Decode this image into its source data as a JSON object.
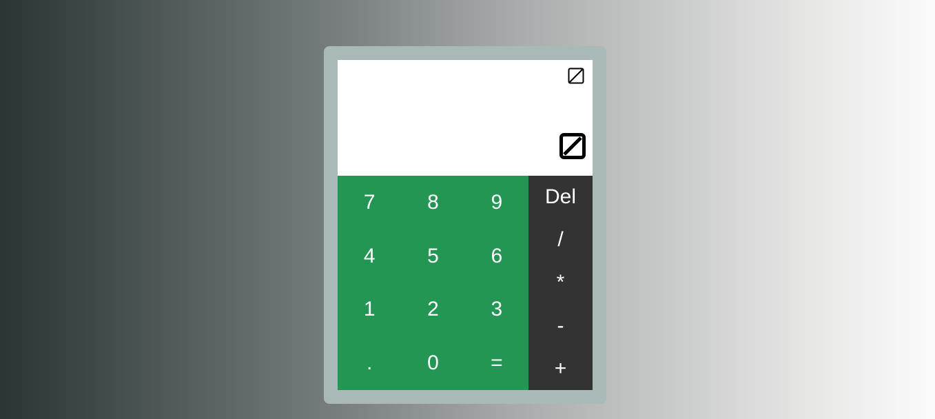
{
  "display": {
    "expression_icon": "no-image-icon",
    "result_icon": "no-image-icon"
  },
  "keypad": {
    "digits": [
      "7",
      "8",
      "9",
      "4",
      "5",
      "6",
      "1",
      "2",
      "3",
      ".",
      "0",
      "="
    ]
  },
  "operators": {
    "keys": [
      "Del",
      "/",
      "*",
      "-",
      "+"
    ]
  },
  "colors": {
    "keypad": "#229652",
    "operators": "#333333",
    "frame": "#a9b9b8",
    "display": "#ffffff"
  }
}
